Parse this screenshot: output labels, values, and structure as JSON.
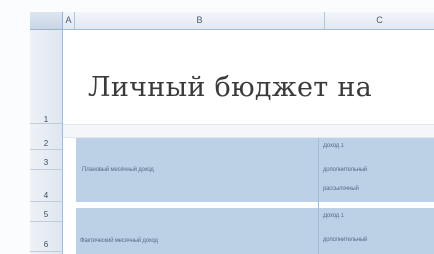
{
  "spreadsheet": {
    "column_headers": [
      "A",
      "B",
      "C"
    ],
    "row_headers": [
      "1",
      "2",
      "3",
      "4",
      "5",
      "6"
    ],
    "title": "Личный бюджет на",
    "rows": [
      {
        "label": "Плановый месячный доход",
        "note_lines": [
          "Доход 1",
          "дополнительный",
          "рассылочный"
        ]
      },
      {
        "label": "Фактический месячный доход",
        "note_lines": [
          "Доход 1",
          "дополнительный"
        ]
      }
    ]
  },
  "colors": {
    "label_band": "#bcd0e6",
    "header_fill": "#dfe6ef",
    "title_text": "#3a3a3a"
  }
}
